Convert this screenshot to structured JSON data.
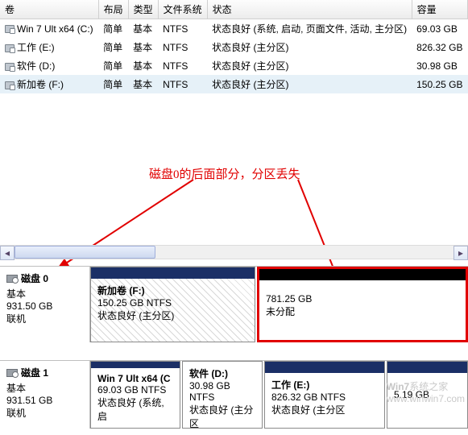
{
  "columns": {
    "c0": "卷",
    "c1": "布局",
    "c2": "类型",
    "c3": "文件系统",
    "c4": "状态",
    "c5": "容量"
  },
  "rows": [
    {
      "name": "Win 7 Ult x64 (C:)",
      "layout": "简单",
      "type": "基本",
      "fs": "NTFS",
      "status": "状态良好 (系统, 启动, 页面文件, 活动, 主分区)",
      "cap": "69.03 GB"
    },
    {
      "name": "工作 (E:)",
      "layout": "简单",
      "type": "基本",
      "fs": "NTFS",
      "status": "状态良好 (主分区)",
      "cap": "826.32 GB"
    },
    {
      "name": "软件 (D:)",
      "layout": "简单",
      "type": "基本",
      "fs": "NTFS",
      "status": "状态良好 (主分区)",
      "cap": "30.98 GB"
    },
    {
      "name": "新加卷 (F:)",
      "layout": "简单",
      "type": "基本",
      "fs": "NTFS",
      "status": "状态良好 (主分区)",
      "cap": "150.25 GB"
    }
  ],
  "annotation": "磁盘0的后面部分，分区丢失",
  "disk0": {
    "title": "磁盘 0",
    "type": "基本",
    "size": "931.50 GB",
    "state": "联机",
    "p1": {
      "name": "新加卷 (F:)",
      "size": "150.25 GB NTFS",
      "status": "状态良好 (主分区)"
    },
    "p2": {
      "size": "781.25 GB",
      "status": "未分配"
    }
  },
  "disk1": {
    "title": "磁盘 1",
    "type": "基本",
    "size": "931.51 GB",
    "state": "联机",
    "p1": {
      "name": "Win 7 Ult x64 (C",
      "size": "69.03 GB NTFS",
      "status": "状态良好 (系统, 启"
    },
    "p2": {
      "name": "软件 (D:)",
      "size": "30.98 GB NTFS",
      "status": "状态良好 (主分区"
    },
    "p3": {
      "name": "工作 (E:)",
      "size": "826.32 GB NTFS",
      "status": "状态良好 (主分区"
    },
    "p4": {
      "size": "5.19 GB",
      "status": ""
    }
  },
  "watermark": {
    "brand": "Win7",
    "text": "系统之家",
    "url": "www.winwin7.com"
  }
}
